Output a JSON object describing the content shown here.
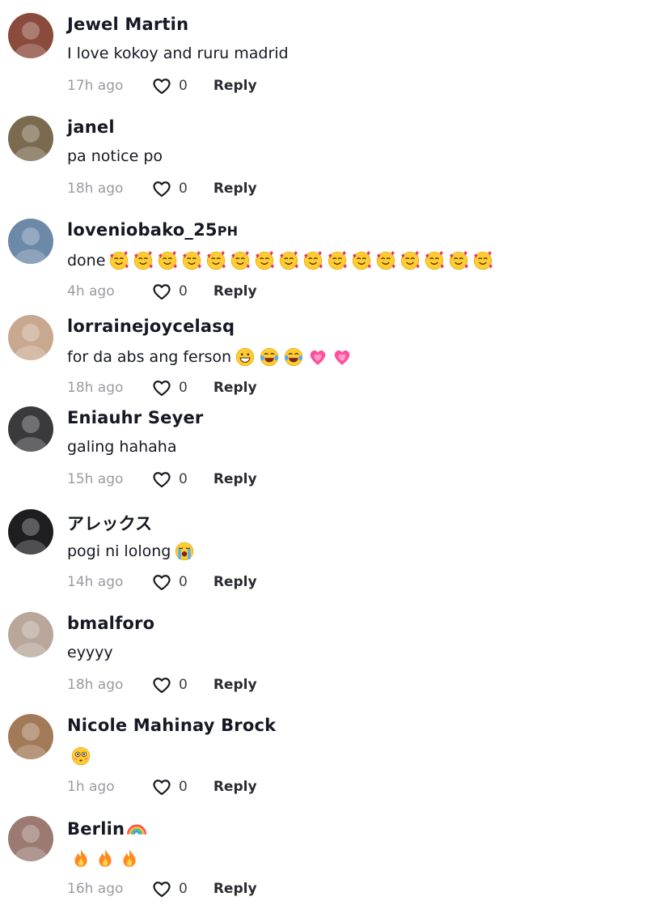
{
  "comments": [
    {
      "user": "Jewel Martin",
      "suffix": "",
      "text": "I love kokoy and ruru madrid",
      "emojis": [],
      "time": "17h ago",
      "likes": "0",
      "reply": "Reply",
      "avatar_color": "#8a4a3c"
    },
    {
      "user": "janel",
      "suffix": "",
      "text": "pa notice po",
      "emojis": [],
      "time": "18h ago",
      "likes": "0",
      "reply": "Reply",
      "avatar_color": "#7a6a4f"
    },
    {
      "user": "loveniobako_25",
      "suffix": "PH",
      "text": "done",
      "emojis": [
        "smiling-hearts-emoji",
        "smiling-hearts-emoji",
        "smiling-hearts-emoji",
        "smiling-hearts-emoji",
        "smiling-hearts-emoji",
        "smiling-hearts-emoji",
        "smiling-hearts-emoji",
        "smiling-hearts-emoji",
        "smiling-hearts-emoji",
        "smiling-hearts-emoji",
        "smiling-hearts-emoji",
        "smiling-hearts-emoji",
        "smiling-hearts-emoji",
        "smiling-hearts-emoji",
        "smiling-hearts-emoji",
        "smiling-hearts-emoji"
      ],
      "time": "4h ago",
      "likes": "0",
      "reply": "Reply",
      "avatar_color": "#6c8aa8"
    },
    {
      "user": "lorrainejoycelasq",
      "suffix": "",
      "text": "for da abs ang ferson",
      "emojis": [
        "grinning-emoji",
        "laughing-tears-emoji",
        "laughing-tears-emoji",
        "heart-emoji",
        "heart-emoji"
      ],
      "time": "18h ago",
      "likes": "0",
      "reply": "Reply",
      "avatar_color": "#c9a890"
    },
    {
      "user": "Eniauhr Seyer",
      "suffix": "",
      "text": "galing hahaha",
      "emojis": [],
      "time": "15h ago",
      "likes": "0",
      "reply": "Reply",
      "avatar_color": "#3a3a3c"
    },
    {
      "user": "アレックス",
      "suffix": "",
      "text": "pogi ni lolong",
      "emojis": [
        "crying-emoji"
      ],
      "time": "14h ago",
      "likes": "0",
      "reply": "Reply",
      "avatar_color": "#1e1e20"
    },
    {
      "user": "bmalforo",
      "suffix": "",
      "text": "eyyyy",
      "emojis": [],
      "time": "18h ago",
      "likes": "0",
      "reply": "Reply",
      "avatar_color": "#b8a79a"
    },
    {
      "user": "Nicole Mahinay Brock",
      "suffix": "",
      "text": "",
      "emojis": [
        "flushed-emoji"
      ],
      "time": "1h ago",
      "likes": "0",
      "reply": "Reply",
      "avatar_color": "#a27a58"
    },
    {
      "user": "Berlin",
      "suffix": "",
      "text": "",
      "emojis": [
        "fire-emoji",
        "fire-emoji",
        "fire-emoji"
      ],
      "name_emoji": "rainbow-emoji",
      "time": "16h ago",
      "likes": "0",
      "reply": "Reply",
      "avatar_color": "#9c7a72"
    }
  ]
}
